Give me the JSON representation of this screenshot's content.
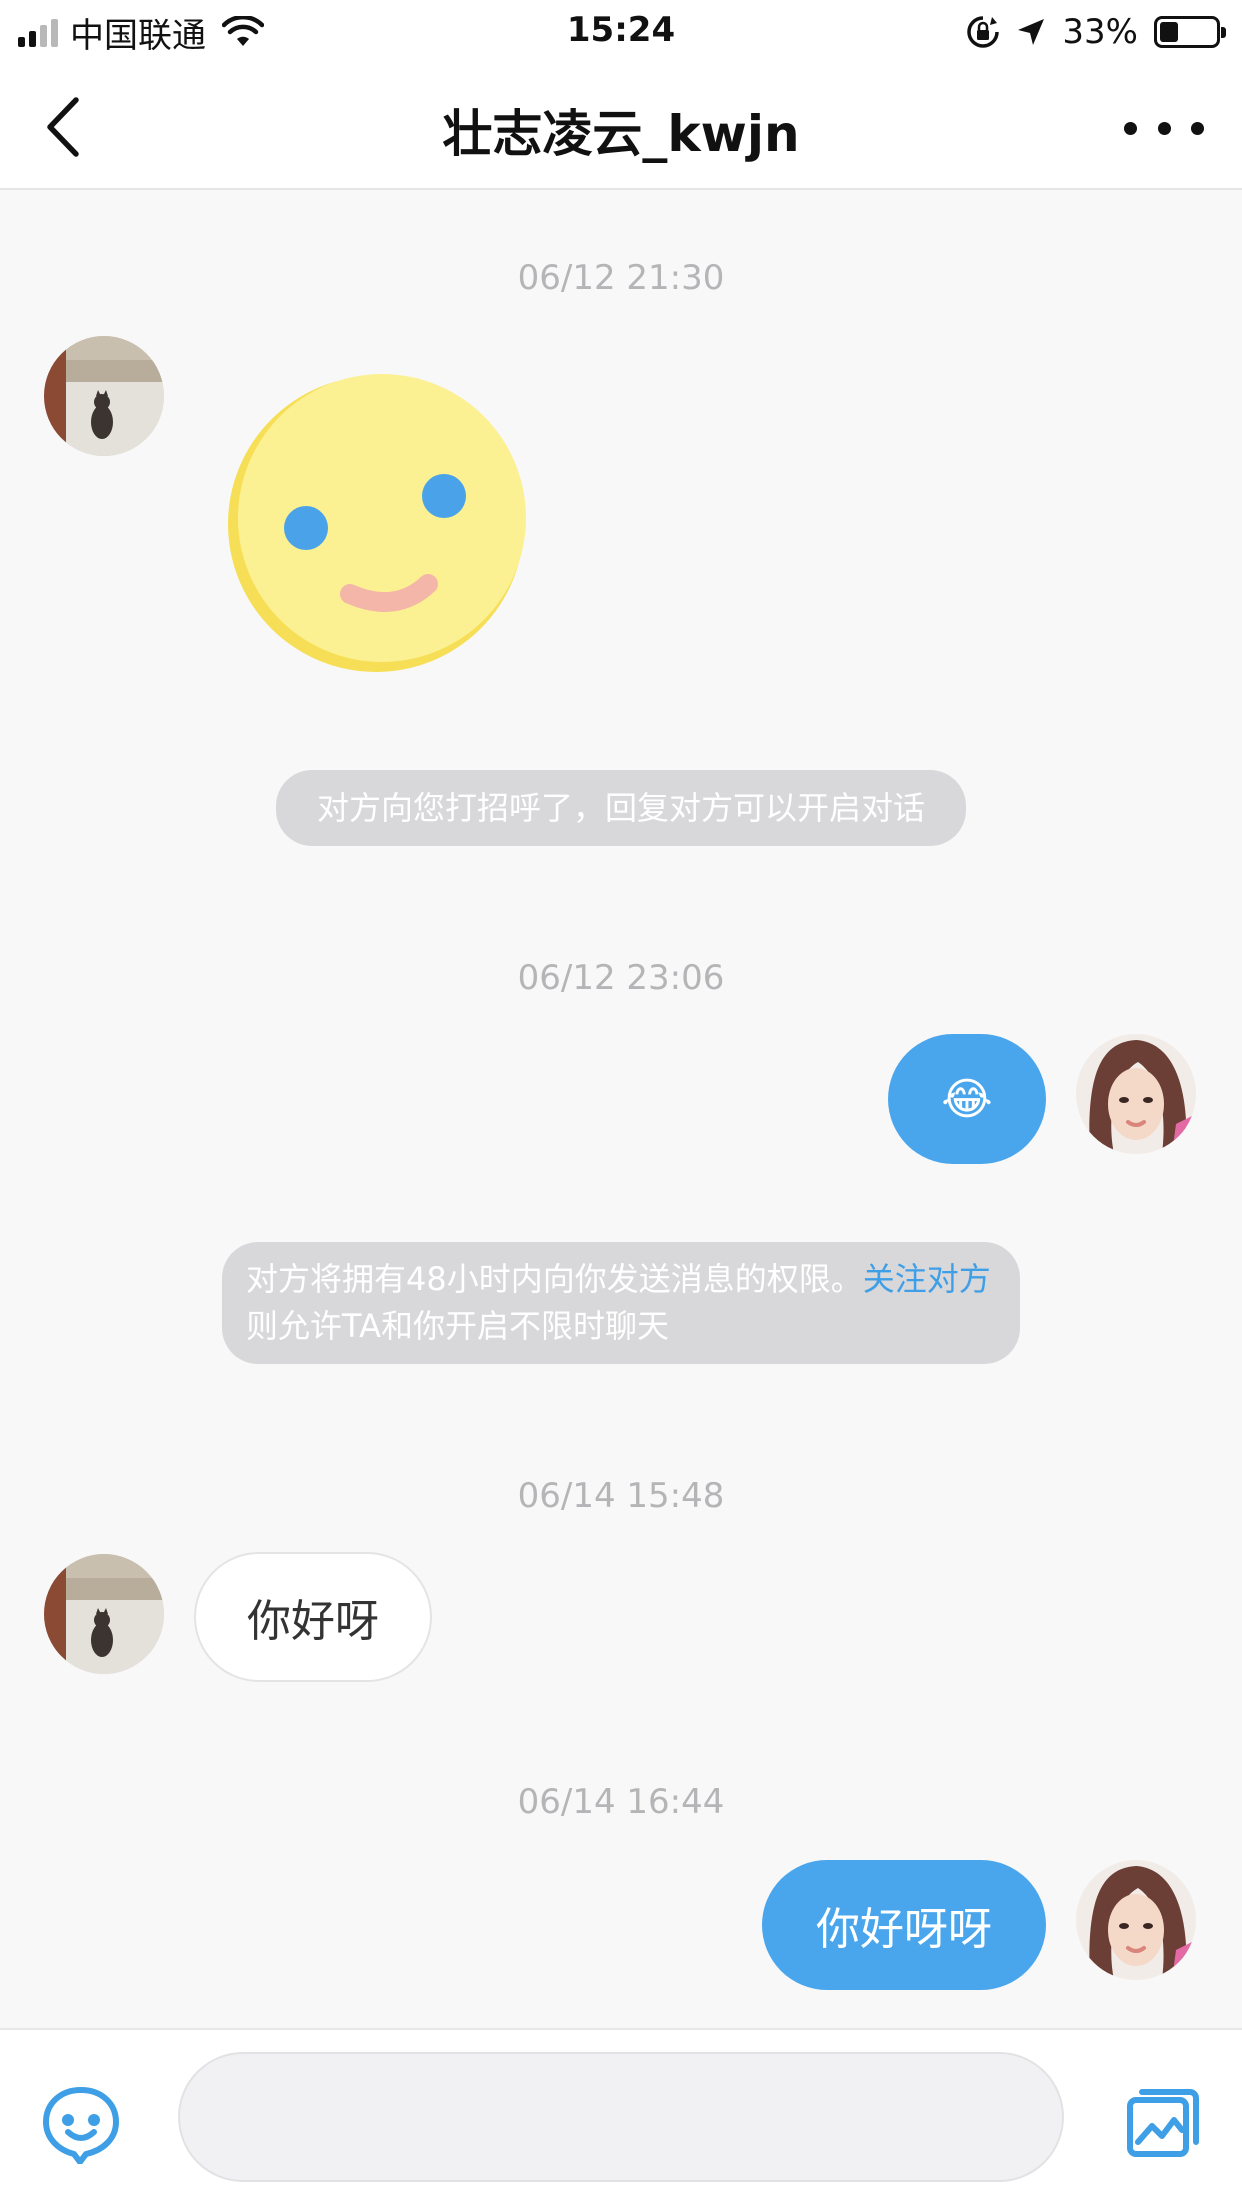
{
  "status_bar": {
    "carrier": "中国联通",
    "time": "15:24",
    "battery_percent": "33%",
    "battery_level": 0.33,
    "signal_bars_filled": 2,
    "signal_bars_total": 4
  },
  "nav": {
    "title": "壮志凌云_kwjn",
    "back_icon": "chevron-left-icon",
    "more_icon": "more-dots-icon"
  },
  "messages": {
    "ts1": "06/12 21:30",
    "sys1": "对方向您打招呼了，回复对方可以开启对话",
    "ts2": "06/12 23:06",
    "emoji_reply": "😂",
    "sys2_text": "对方将拥有48小时内向你发送消息的权限。",
    "sys2_link": "关注对方",
    "sys2_tail": "则允许TA和你开启不限时聊天",
    "ts3": "06/14 15:48",
    "msg_left": "你好呀",
    "ts4": "06/14 16:44",
    "msg_right": "你好呀呀"
  },
  "input": {
    "placeholder": "",
    "emoji_icon": "smiley-face-icon",
    "album_icon": "photo-album-icon"
  },
  "colors": {
    "accent": "#4aa6ec",
    "link": "#3f9fe6",
    "sticker_face": "#fcf192",
    "sticker_eyes": "#4aa3e8"
  }
}
